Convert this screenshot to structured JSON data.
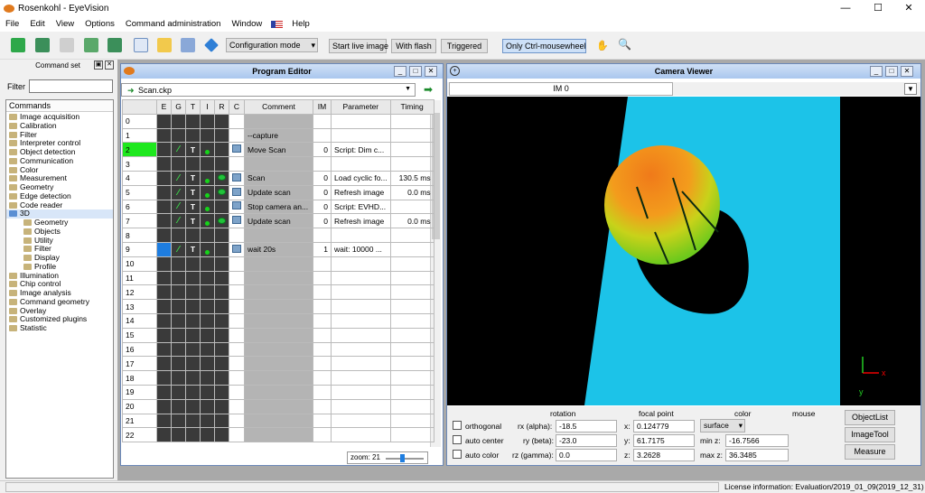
{
  "app": {
    "title": "Rosenkohl - EyeVision"
  },
  "window_controls": {
    "minimize": "—",
    "maximize": "☐",
    "close": "✕"
  },
  "menu": [
    "File",
    "Edit",
    "View",
    "Options",
    "Command administration",
    "Window",
    "Help"
  ],
  "toolbar": {
    "config_mode": "Configuration mode",
    "config_arrow": "▾",
    "start_live": "Start live image",
    "with_flash": "With flash",
    "triggered": "Triggered",
    "only_ctrl": "Only Ctrl-mousewheel",
    "hand_icon": "✋",
    "zoom_icon": "🔍"
  },
  "command_set": {
    "title": "Command set",
    "filter_label": "Filter",
    "filter_value": "",
    "header": "Commands",
    "items": [
      {
        "label": "Image acquisition",
        "indent": 0
      },
      {
        "label": "Calibration",
        "indent": 0
      },
      {
        "label": "Filter",
        "indent": 0
      },
      {
        "label": "Interpreter control",
        "indent": 0
      },
      {
        "label": "Object detection",
        "indent": 0
      },
      {
        "label": "Communication",
        "indent": 0
      },
      {
        "label": "Color",
        "indent": 0
      },
      {
        "label": "Measurement",
        "indent": 0
      },
      {
        "label": "Geometry",
        "indent": 0
      },
      {
        "label": "Edge detection",
        "indent": 0
      },
      {
        "label": "Code reader",
        "indent": 0
      },
      {
        "label": "3D",
        "indent": 0,
        "selected": true
      },
      {
        "label": "Geometry",
        "indent": 1
      },
      {
        "label": "Objects",
        "indent": 1
      },
      {
        "label": "Utility",
        "indent": 1
      },
      {
        "label": "Filter",
        "indent": 1
      },
      {
        "label": "Display",
        "indent": 1
      },
      {
        "label": "Profile",
        "indent": 1
      },
      {
        "label": "Illumination",
        "indent": 0
      },
      {
        "label": "Chip control",
        "indent": 0
      },
      {
        "label": "Image analysis",
        "indent": 0
      },
      {
        "label": "Command geometry",
        "indent": 0
      },
      {
        "label": "Overlay",
        "indent": 0
      },
      {
        "label": "Customized plugins",
        "indent": 0
      },
      {
        "label": "Statistic",
        "indent": 0
      }
    ]
  },
  "program_editor": {
    "title": "Program Editor",
    "file": "Scan.ckp",
    "dropdown_arrow": "▼",
    "run_icon": "➡",
    "zoom_label": "zoom: 21",
    "columns": [
      "E",
      "G",
      "T",
      "I",
      "R",
      "C",
      "Comment",
      "IM",
      "Parameter",
      "Timing"
    ],
    "rows": [
      {
        "n": "0",
        "comment": "",
        "im": "",
        "param": "",
        "timing": ""
      },
      {
        "n": "1",
        "comment": "--capture",
        "im": "",
        "param": "",
        "timing": ""
      },
      {
        "n": "2",
        "comment": "Move Scan",
        "im": "0",
        "param": "Script: Dim c...",
        "timing": "",
        "g": true,
        "t": true,
        "r": true,
        "icon": "script",
        "active": true
      },
      {
        "n": "3",
        "comment": "",
        "im": "",
        "param": "",
        "timing": ""
      },
      {
        "n": "4",
        "comment": "Scan",
        "im": "0",
        "param": "Load cyclic fo...",
        "timing": "130.5 ms",
        "g": true,
        "t": true,
        "r": true,
        "eye": true,
        "icon": "camera"
      },
      {
        "n": "5",
        "comment": "Update scan",
        "im": "0",
        "param": "Refresh image",
        "timing": "0.0 ms",
        "g": true,
        "t": true,
        "r": true,
        "eye": true,
        "icon": "update"
      },
      {
        "n": "6",
        "comment": "Stop camera an...",
        "im": "0",
        "param": "Script: EVHD...",
        "timing": "",
        "g": true,
        "t": true,
        "r": true,
        "icon": "script"
      },
      {
        "n": "7",
        "comment": "Update scan",
        "im": "0",
        "param": "Refresh image",
        "timing": "0.0 ms",
        "g": true,
        "t": true,
        "r": true,
        "eye": true,
        "icon": "update"
      },
      {
        "n": "8",
        "comment": "",
        "im": "",
        "param": "",
        "timing": ""
      },
      {
        "n": "9",
        "comment": "wait 20s",
        "im": "1",
        "param": "wait: 10000 ...",
        "timing": "",
        "g": true,
        "t": true,
        "r": true,
        "icon": "timer",
        "selected": true
      },
      {
        "n": "10"
      },
      {
        "n": "11"
      },
      {
        "n": "12"
      },
      {
        "n": "13"
      },
      {
        "n": "14"
      },
      {
        "n": "15"
      },
      {
        "n": "16"
      },
      {
        "n": "17"
      },
      {
        "n": "18"
      },
      {
        "n": "19"
      },
      {
        "n": "20"
      },
      {
        "n": "21"
      },
      {
        "n": "22"
      }
    ]
  },
  "camera_viewer": {
    "title": "Camera Viewer",
    "tab": "IM 0",
    "dropdown_arrow": "▼",
    "axes": {
      "x": "x",
      "y": "y"
    },
    "controls": {
      "headers": {
        "rotation": "rotation",
        "focal_point": "focal point",
        "color": "color",
        "mouse": "mouse"
      },
      "orthogonal": "orthogonal",
      "auto_center": "auto center",
      "auto_color": "auto color",
      "rx_label": "rx (alpha):",
      "rx": "-18.5",
      "ry_label": "ry (beta):",
      "ry": "-23.0",
      "rz_label": "rz (gamma):",
      "rz": "0.0",
      "x_label": "x:",
      "x": "0.124779",
      "y_label": "y:",
      "y": "61.7175",
      "z_label": "z:",
      "z": "3.2628",
      "color_mode": "surface",
      "color_arrow": "▾",
      "minz_label": "min z:",
      "minz": "-16.7566",
      "maxz_label": "max z:",
      "maxz": "36.3485",
      "objectlist": "ObjectList",
      "imagetool": "ImageTool",
      "measure": "Measure"
    }
  },
  "status": {
    "license": "License information: Evaluation/2019_01_09(2019_12_31)"
  }
}
